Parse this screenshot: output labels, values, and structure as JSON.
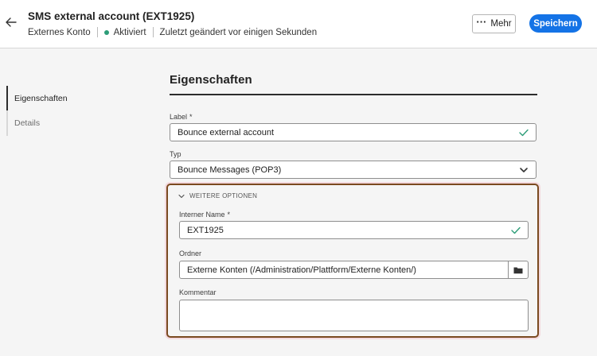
{
  "header": {
    "title": "SMS external account (EXT1925)",
    "type_label": "Externes Konto",
    "status": "Aktiviert",
    "modified": "Zuletzt geändert vor einigen Sekunden",
    "more_label": "Mehr",
    "save_label": "Speichern"
  },
  "sidebar": {
    "items": [
      {
        "label": "Eigenschaften",
        "active": true
      },
      {
        "label": "Details",
        "active": false
      }
    ]
  },
  "section": {
    "title": "Eigenschaften"
  },
  "form": {
    "label": {
      "label": "Label",
      "required": "*",
      "value": "Bounce external account"
    },
    "type": {
      "label": "Typ",
      "value": "Bounce Messages (POP3)"
    },
    "more_options": {
      "toggle_label": "WEITERE OPTIONEN",
      "internal_name": {
        "label": "Interner Name",
        "required": "*",
        "value": "EXT1925"
      },
      "folder": {
        "label": "Ordner",
        "value": "Externe Konten (/Administration/Plattform/Externe Konten/)"
      },
      "comment": {
        "label": "Kommentar",
        "value": ""
      }
    }
  },
  "icons": {
    "back": "arrow-left-icon",
    "more": "ellipsis-icon",
    "check": "checkmark-icon",
    "dropdown": "chevron-down-icon",
    "toggle": "chevron-down-icon",
    "folder": "folder-icon"
  },
  "colors": {
    "accent": "#1473e6",
    "status_ok": "#2d9d78",
    "highlight_border": "#7a4a20"
  }
}
